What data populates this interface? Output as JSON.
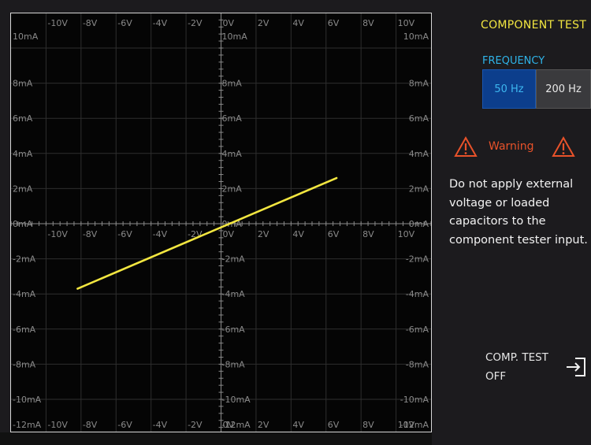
{
  "plot": {
    "x_top_labels": [
      "-10V",
      "-8V",
      "-6V",
      "-4V",
      "-2V",
      "0V",
      "2V",
      "4V",
      "6V",
      "8V",
      "10V"
    ],
    "x_mid_labels": [
      "-10V",
      "-8V",
      "-6V",
      "-4V",
      "-2V",
      "0V",
      "2V",
      "4V",
      "6V",
      "8V",
      "10V"
    ],
    "x_bottom_labels": [
      "-10V",
      "-8V",
      "-6V",
      "-4V",
      "-2V",
      "0V",
      "2V",
      "4V",
      "6V",
      "8V",
      "10V"
    ],
    "y_labels": [
      "10mA",
      "8mA",
      "6mA",
      "4mA",
      "2mA",
      "0mA",
      "-2mA",
      "-4mA",
      "-6mA",
      "-8mA",
      "-10mA",
      "-12mA"
    ],
    "trace": {
      "x_start_V": -8.2,
      "y_start_mA": -3.7,
      "x_end_V": 6.6,
      "y_end_mA": 2.6,
      "color": "#f2e640"
    },
    "grid_color": "#2e2e2e",
    "axis_color": "#8a8a8a"
  },
  "panel": {
    "title": "COMPONENT TEST",
    "frequency_label": "FREQUENCY",
    "freq_options": [
      "50 Hz",
      "200 Hz"
    ],
    "selected_freq": "50 Hz",
    "warning_title": "Warning",
    "warning_message": "Do not apply external voltage or loaded capacitors to the component tester input.",
    "comp_test_line1": "COMP. TEST",
    "comp_test_line2": "OFF",
    "accent_yellow": "#f2e640",
    "accent_blue": "#2fb3e8",
    "warning_color": "#e8522a"
  }
}
